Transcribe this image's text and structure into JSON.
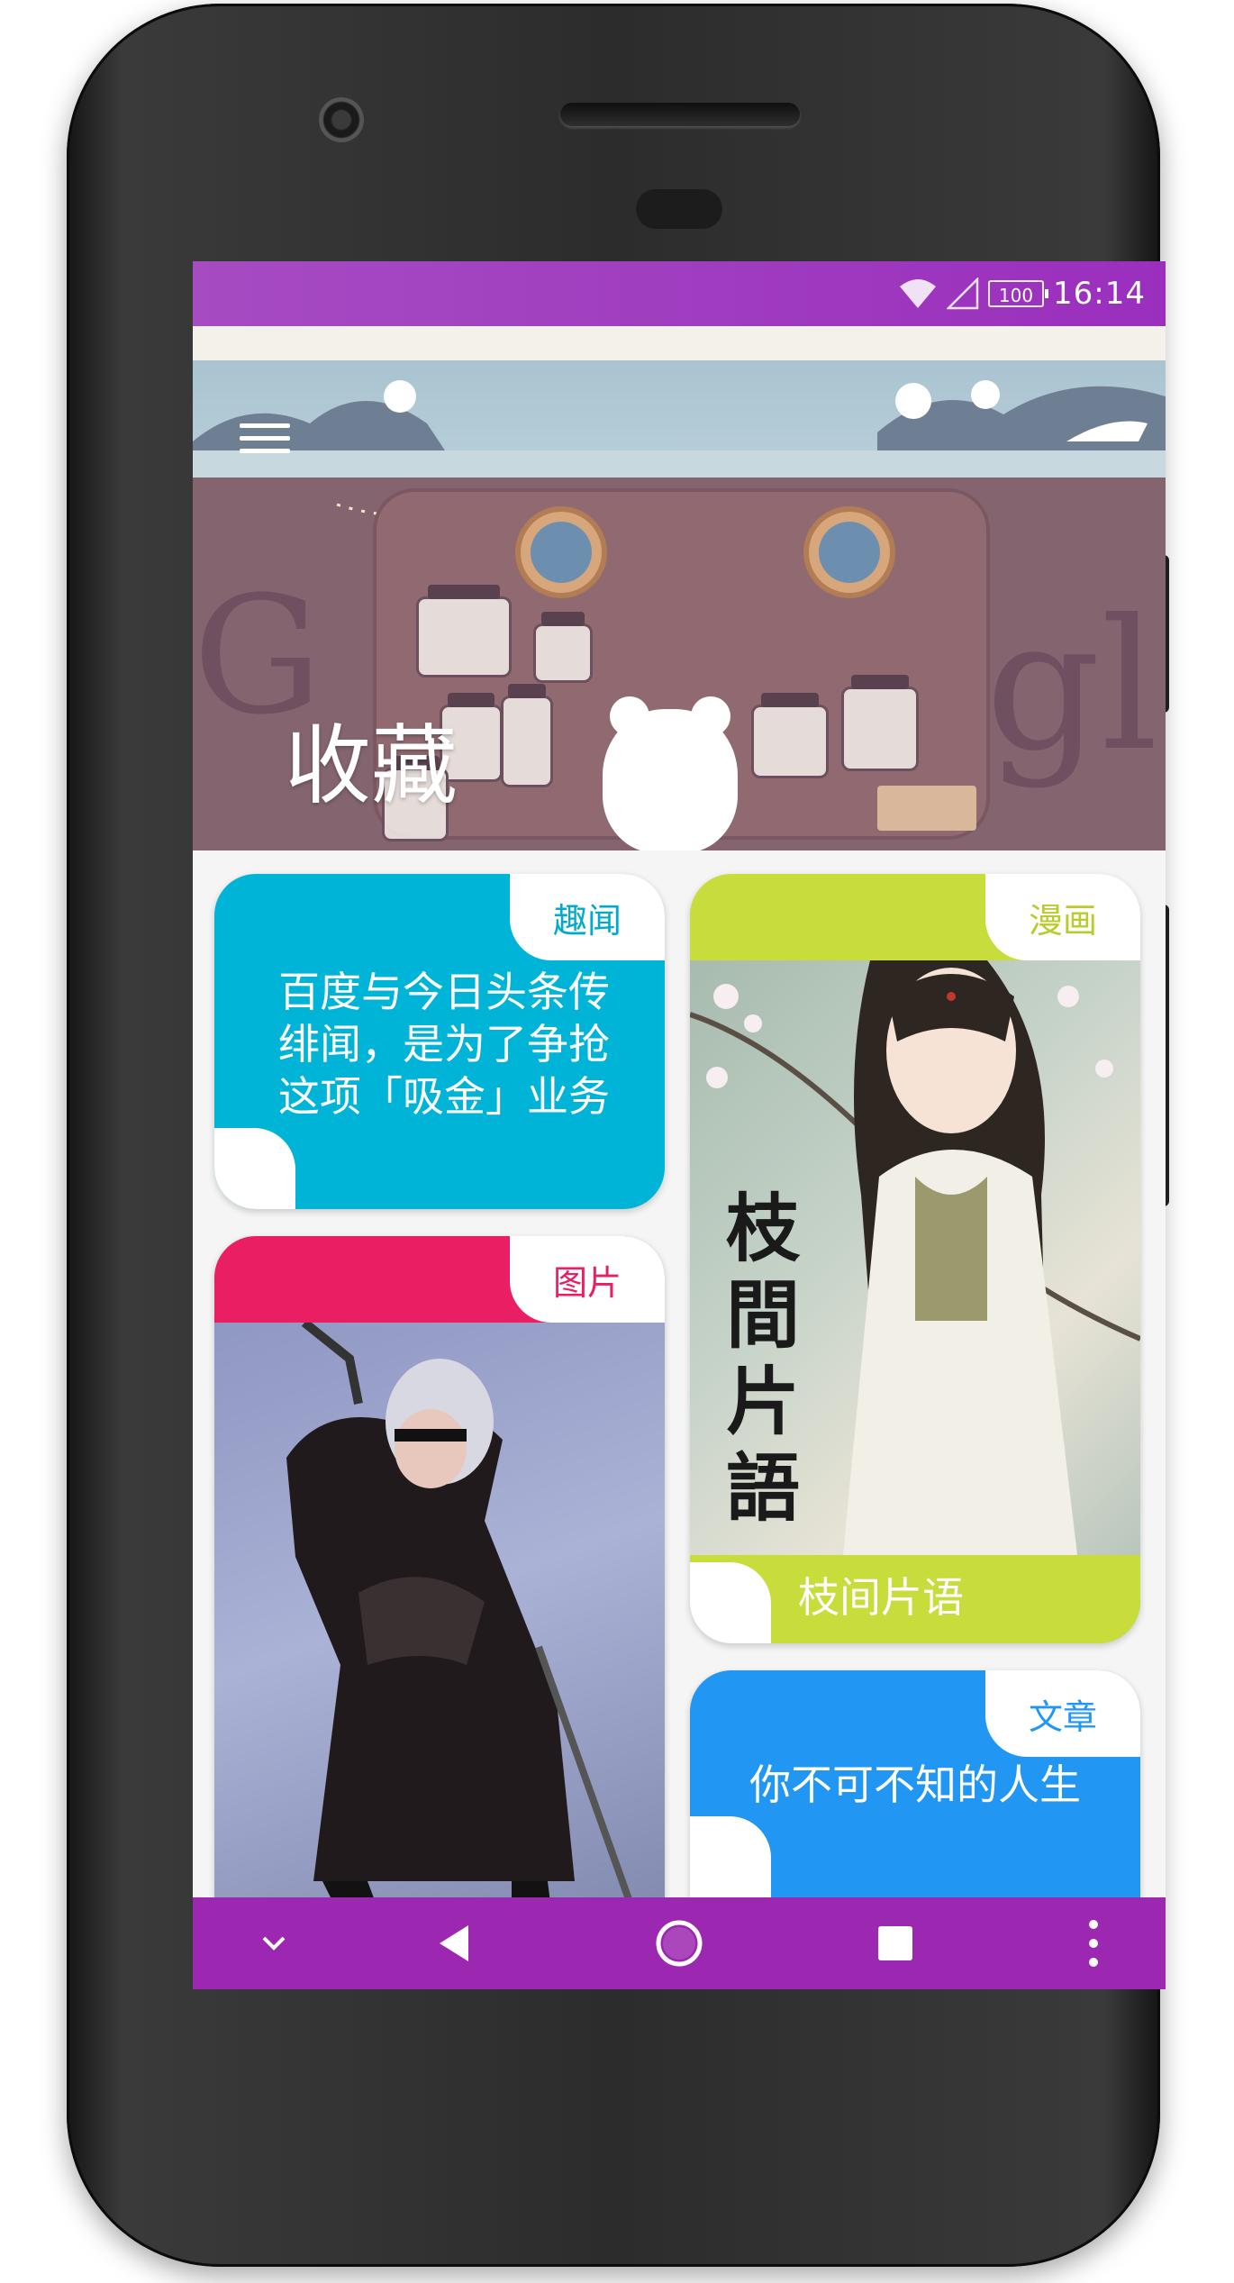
{
  "status_bar": {
    "time": "16:14",
    "battery": "100",
    "background": "#9c27b0"
  },
  "header": {
    "title": "收藏",
    "menu_icon": "hamburger-menu-icon"
  },
  "cards": [
    {
      "tag": "趣闻",
      "color": "#00b4d8",
      "text_lines": [
        "百度与今日头条传",
        "绯闻，是为了争抢",
        "这项「吸金」业务"
      ]
    },
    {
      "tag": "漫画",
      "color": "#c8dc3c",
      "image_title": [
        "枝",
        "間",
        "片",
        "語"
      ],
      "caption": "枝间片语"
    },
    {
      "tag": "图片",
      "color": "#e91e63"
    },
    {
      "tag": "文章",
      "color": "#2196f3",
      "text_lines": [
        "你不可不知的人生"
      ]
    }
  ],
  "nav_bar": {
    "icons": [
      "chevron-down-icon",
      "back-icon",
      "home-icon",
      "recents-icon",
      "more-vert-icon"
    ]
  }
}
